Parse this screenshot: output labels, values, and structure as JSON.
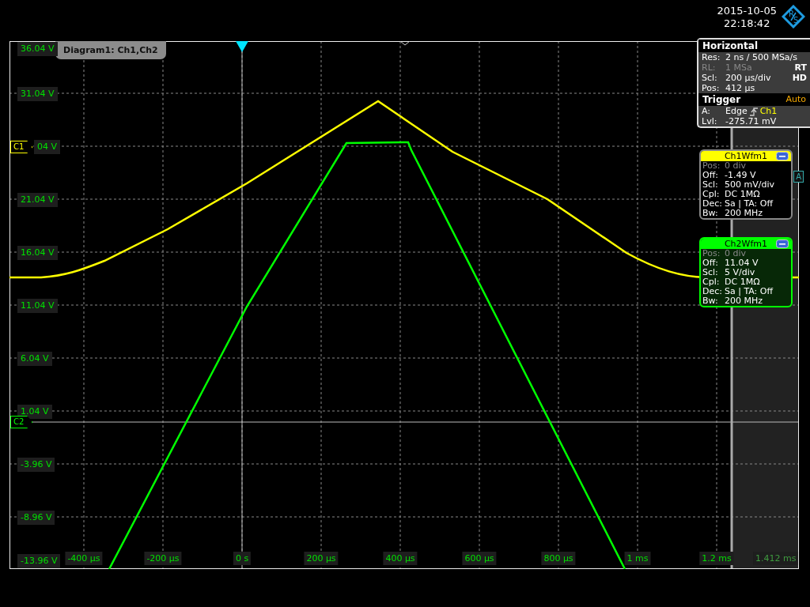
{
  "header": {
    "date": "2015-10-05",
    "time": "22:18:42",
    "logo_letters": [
      "R",
      "S"
    ]
  },
  "diagram": {
    "title": "Diagram1: Ch1,Ch2",
    "y_labels": [
      "36.04 V",
      "31.04 V",
      "04 V",
      "21.04 V",
      "16.04 V",
      "11.04 V",
      "6.04 V",
      "1.04 V",
      "-3.96 V",
      "-8.96 V",
      "-13.96 V"
    ],
    "x_labels": [
      {
        "text": "-400 µs",
        "dim": false
      },
      {
        "text": "-200 µs",
        "dim": false
      },
      {
        "text": "0 s",
        "dim": false
      },
      {
        "text": "200 µs",
        "dim": false
      },
      {
        "text": "400 µs",
        "dim": false
      },
      {
        "text": "600 µs",
        "dim": false
      },
      {
        "text": "800 µs",
        "dim": false
      },
      {
        "text": "1 ms",
        "dim": false
      },
      {
        "text": "1.2 ms",
        "dim": false
      },
      {
        "text": "1.412 ms",
        "dim": true
      }
    ],
    "channel_markers": [
      {
        "label": "C1",
        "color": "#ffff00"
      },
      {
        "label": "C2",
        "color": "#00ff00"
      }
    ],
    "side_tab": "A"
  },
  "horizontal": {
    "title": "Horizontal",
    "rows": [
      {
        "label": "Res:",
        "value": "2 ns / 500 MSa/s",
        "disabled": false
      },
      {
        "label": "RL:",
        "value": "1 MSa",
        "disabled": true,
        "badge": "RT"
      },
      {
        "label": "Scl:",
        "value": "200 µs/div",
        "disabled": false,
        "badge": "HD"
      },
      {
        "label": "Pos:",
        "value": "412 µs",
        "disabled": false
      }
    ]
  },
  "trigger": {
    "title": "Trigger",
    "mode": "Auto",
    "rows": [
      {
        "label": "A:",
        "value": "Edge",
        "source": "Ch1"
      },
      {
        "label": "Lvl:",
        "value": "-275.71 mV"
      }
    ]
  },
  "channels": [
    {
      "title": "Ch1Wfm1",
      "color": "#ffff00",
      "rows": [
        {
          "label": "Pos:",
          "value": "0 div",
          "disabled": true
        },
        {
          "label": "Off:",
          "value": "-1.49 V",
          "disabled": false
        },
        {
          "label": "Scl:",
          "value": "500 mV/div",
          "disabled": false
        },
        {
          "label": "Cpl:",
          "value": "DC 1MΩ",
          "disabled": false
        },
        {
          "label": "Dec:",
          "value": "Sa | TA: Off",
          "disabled": false
        },
        {
          "label": "Bw:",
          "value": "200 MHz",
          "disabled": false
        }
      ]
    },
    {
      "title": "Ch2Wfm1",
      "color": "#00ff00",
      "rows": [
        {
          "label": "Pos:",
          "value": "0 div",
          "disabled": true
        },
        {
          "label": "Off:",
          "value": "11.04 V",
          "disabled": false
        },
        {
          "label": "Scl:",
          "value": "5 V/div",
          "disabled": false
        },
        {
          "label": "Cpl:",
          "value": "DC 1MΩ",
          "disabled": false
        },
        {
          "label": "Dec:",
          "value": "Sa | TA: Off",
          "disabled": false
        },
        {
          "label": "Bw:",
          "value": "200 MHz",
          "disabled": false
        }
      ]
    }
  ]
}
